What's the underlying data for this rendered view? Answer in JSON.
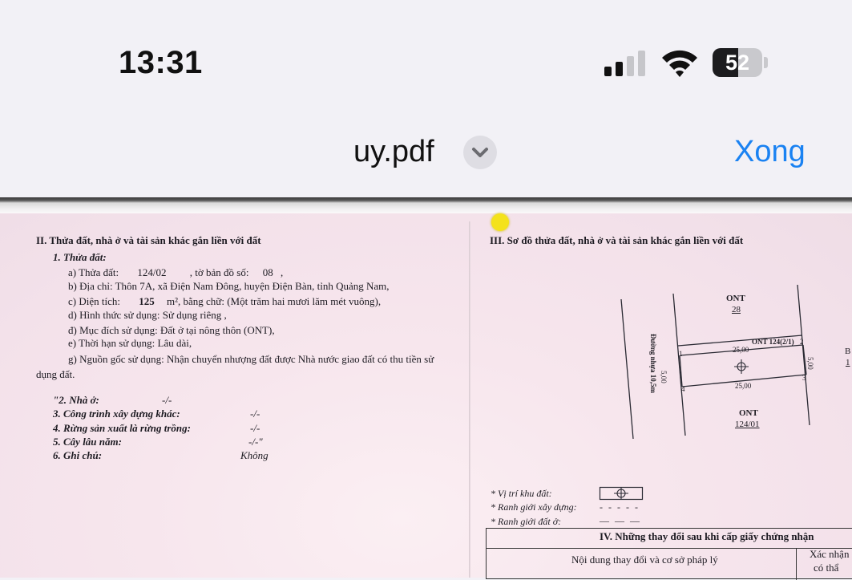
{
  "status_bar": {
    "time": "13:31",
    "signal_icon": "cellular-signal-icon",
    "wifi_icon": "wifi-icon",
    "battery_level": "52",
    "battery_fraction": 0.52
  },
  "nav": {
    "title": "uy.pdf",
    "title_menu_icon": "chevron-down-icon",
    "done_label": "Xong",
    "accent_color": "#1a82f2"
  },
  "document": {
    "left": {
      "section_heading": "II. Thửa đất, nhà ở và tài sản khác gắn liền với đất",
      "sub1_heading": "1. Thửa đất:",
      "parcel_prefix": "a) Thửa đất:",
      "parcel_no": "124/02",
      "sheet_prefix": ", tờ bản đồ số:",
      "sheet_no": "08",
      "sheet_suffix": ",",
      "address": "b) Địa chỉ: Thôn 7A, xã Điện Nam Đông, huyện Điện Bàn, tỉnh Quảng Nam,",
      "area_prefix": "c) Diện tích:",
      "area_value": "125",
      "area_suffix": "m², bằng chữ: (Một trăm hai mươi lăm mét vuông),",
      "use_form": "d) Hình thức sử dụng:  Sử dụng riêng ,",
      "use_purpose": "đ) Mục đích sử dụng:  Đất ở tại nông thôn (ONT),",
      "use_term": "e) Thời hạn sử dụng:   Lâu dài,",
      "origin_line1": "g) Nguồn gốc sử dụng:  Nhận chuyển nhượng đất được Nhà nước giao đất có thu tiền sử",
      "origin_line2": "dụng đất.",
      "items": [
        {
          "label": "\"2. Nhà ở:",
          "value": "-/-"
        },
        {
          "label": "3. Công trình xây dựng khác:",
          "value": "-/-"
        },
        {
          "label": "4. Rừng sản xuất là rừng trồng:",
          "value": "-/-"
        },
        {
          "label": "5. Cây lâu năm:",
          "value": "-/-\""
        },
        {
          "label": "6. Ghi chú:",
          "value": "Không"
        }
      ]
    },
    "right": {
      "section_heading": "III. Sơ đồ thửa đất, nhà ở và tài sản khác gắn liền với đất",
      "map": {
        "north_label": "ONT",
        "north_no": "28",
        "parcel_label": "ONT 124(2/1)",
        "south_label": "ONT",
        "south_no": "124/01",
        "road_label": "Đường nhựa 10,5m",
        "top_length": "25,00",
        "bottom_length": "25,00",
        "left_width": "5,00",
        "right_width": "5,00",
        "corner_1": "1",
        "corner_2": "2",
        "corner_3": "3",
        "corner_4": "4",
        "edge_letter": "B",
        "edge_digit": "1"
      },
      "legend": {
        "location": "* Vị trí khu đất:",
        "construction": "* Ranh giới xây dựng:",
        "construction_dash": "- - - - -",
        "boundary": "* Ranh giới đất ở:",
        "boundary_dash": "— — —"
      },
      "changes_table": {
        "heading": "IV. Những thay đổi sau khi cấp giấy chứng nhận",
        "col1": "Nội dung thay đổi và cơ sở pháp lý",
        "col2_line1": "Xác nhận",
        "col2_line2": "có thẩ"
      }
    }
  }
}
